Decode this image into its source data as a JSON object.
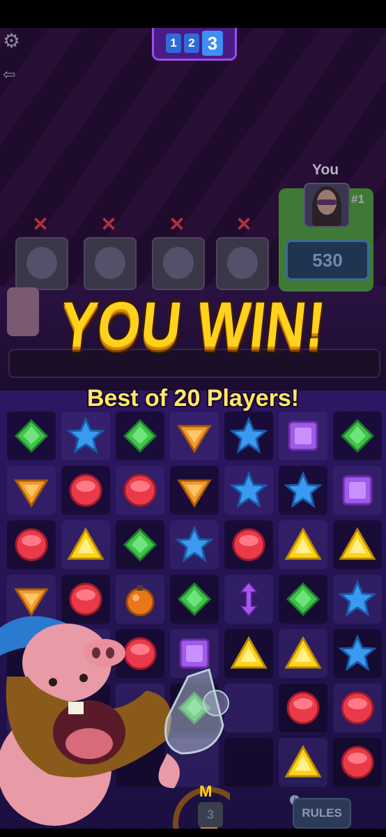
{
  "round_indicator": {
    "rounds": [
      "1",
      "2",
      "3"
    ],
    "current": "3"
  },
  "players": {
    "you_label": "You",
    "rank": "#1",
    "score": "530",
    "eliminated_count": 4
  },
  "result": {
    "title": "YOU WIN!",
    "subtitle": "Best of 20 Players!"
  },
  "board": {
    "rows": [
      [
        "green-diamond",
        "blue-star",
        "green-diamond",
        "orange-shield",
        "blue-star",
        "purple-square",
        "green-diamond"
      ],
      [
        "orange-shield",
        "red-circle",
        "red-circle",
        "orange-shield",
        "blue-star",
        "blue-star",
        "purple-square"
      ],
      [
        "red-circle",
        "yellow-triangle",
        "green-diamond",
        "blue-star",
        "red-circle",
        "yellow-triangle",
        "yellow-triangle"
      ],
      [
        "orange-shield",
        "red-circle",
        "bomb",
        "green-diamond",
        "purple-arrow",
        "green-diamond",
        "blue-star"
      ],
      [
        "",
        "",
        "red-circle",
        "purple-square",
        "yellow-triangle",
        "yellow-triangle",
        "blue-star"
      ],
      [
        "",
        "",
        "",
        "green-diamond",
        "",
        "red-circle",
        "red-circle"
      ],
      [
        "",
        "",
        "",
        "",
        "",
        "yellow-triangle",
        "red-circle"
      ]
    ]
  },
  "controls": {
    "rules_label": "RULES",
    "booster_count": "3",
    "info_symbol": "i"
  },
  "colors": {
    "green": "#3fc24a",
    "blue": "#3a9af0",
    "orange": "#f09a2a",
    "red": "#ea3a4a",
    "yellow": "#ffd21e",
    "purple": "#a05ae8"
  }
}
